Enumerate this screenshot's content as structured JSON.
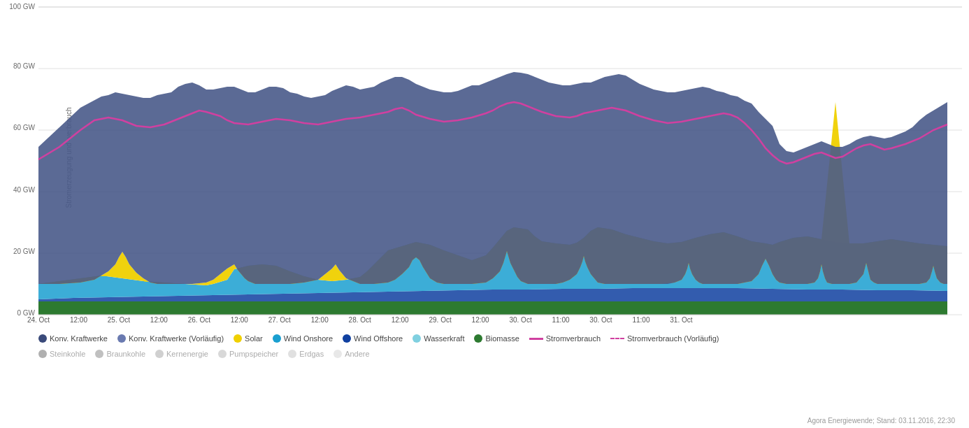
{
  "chart": {
    "title": "Stromerzeugung und -verbrauch",
    "y_axis": {
      "label": "Stromerzeugung und -verbrauch",
      "ticks": [
        {
          "label": "100 GW",
          "pct": 0
        },
        {
          "label": "80 GW",
          "pct": 20
        },
        {
          "label": "60 GW",
          "pct": 40
        },
        {
          "label": "40 GW",
          "pct": 60
        },
        {
          "label": "20 GW",
          "pct": 80
        },
        {
          "label": "0 GW",
          "pct": 100
        }
      ]
    },
    "x_labels": [
      {
        "label": "24. Oct",
        "pct": 0
      },
      {
        "label": "12:00",
        "pct": 4.35
      },
      {
        "label": "25. Oct",
        "pct": 8.7
      },
      {
        "label": "12:00",
        "pct": 13.05
      },
      {
        "label": "26. Oct",
        "pct": 17.4
      },
      {
        "label": "12:00",
        "pct": 21.75
      },
      {
        "label": "27. Oct",
        "pct": 26.1
      },
      {
        "label": "12:00",
        "pct": 30.45
      },
      {
        "label": "28. Oct",
        "pct": 34.8
      },
      {
        "label": "12:00",
        "pct": 39.15
      },
      {
        "label": "29. Oct",
        "pct": 43.5
      },
      {
        "label": "12:00",
        "pct": 47.85
      },
      {
        "label": "30. Oct",
        "pct": 52.2
      },
      {
        "label": "11:00",
        "pct": 56.55
      },
      {
        "label": "30. Oct",
        "pct": 60.9
      },
      {
        "label": "11:00",
        "pct": 65.25
      },
      {
        "label": "31. Oct",
        "pct": 69.6
      }
    ]
  },
  "legend": {
    "row1": [
      {
        "type": "dot",
        "color": "#3a4a7a",
        "label": "Konv. Kraftwerke"
      },
      {
        "type": "dot",
        "color": "#6a7ab0",
        "label": "Konv. Kraftwerke (Vorläufig)"
      },
      {
        "type": "dot",
        "color": "#f0d000",
        "label": "Solar"
      },
      {
        "type": "dot",
        "color": "#1a9fd0",
        "label": "Wind Onshore"
      },
      {
        "type": "dot",
        "color": "#1040a0",
        "label": "Wind Offshore"
      },
      {
        "type": "dot",
        "color": "#80d0e0",
        "label": "Wasserkraft"
      },
      {
        "type": "dot",
        "color": "#2d7a30",
        "label": "Biomasse"
      },
      {
        "type": "line",
        "color": "#d040a0",
        "label": "Stromverbrauch"
      },
      {
        "type": "dashed",
        "color": "#d040a0",
        "label": "Stromverbrauch (Vorläufig)"
      }
    ],
    "row2": [
      {
        "type": "dot",
        "color": "#b0b0b0",
        "label": "Steinkohle"
      },
      {
        "type": "dot",
        "color": "#c8c8c8",
        "label": "Braunkohle"
      },
      {
        "type": "dot",
        "color": "#d8d8d8",
        "label": "Kernenergie"
      },
      {
        "type": "dot",
        "color": "#e0e0e0",
        "label": "Pumpspeicher"
      },
      {
        "type": "dot",
        "color": "#e8e8e8",
        "label": "Erdgas"
      },
      {
        "type": "dot",
        "color": "#f0f0f0",
        "label": "Andere"
      }
    ]
  },
  "watermark": "Agora Energiewende; Stand: 03.11.2016, 22:30"
}
